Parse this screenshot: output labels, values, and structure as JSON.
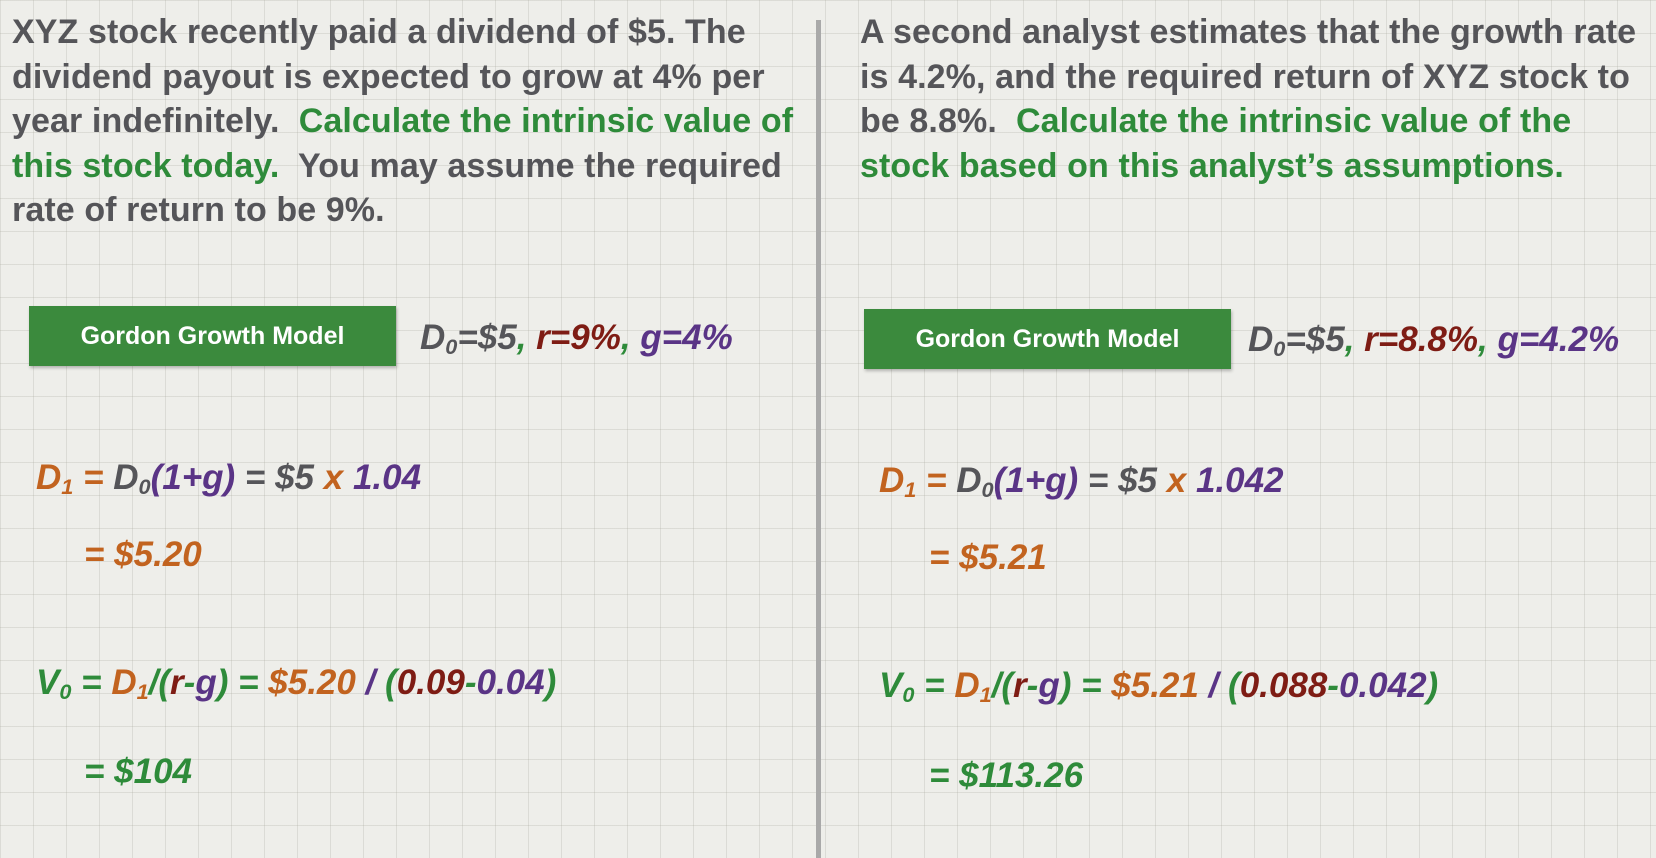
{
  "left": {
    "problem": {
      "text_1": "XYZ stock recently paid a dividend of $5. The dividend payout is expected to grow at 4% per year indefinitely.",
      "green": "Calculate the intrinsic value of this stock today.",
      "text_2": "You may assume the required rate of return to be 9%."
    },
    "model_label": "Gordon Growth Model",
    "given": {
      "d0": "D",
      "d0_sub": "0",
      "d0_val": "=$5",
      "sep": ", ",
      "r": "r=9%",
      "g": "g=4%"
    },
    "d1_line": {
      "d": "D",
      "sub": "1",
      "eq1": " = ",
      "d0": "D",
      "d0_sub": "0",
      "paren": "(1+g)",
      "eq2": " = $5 ",
      "x": "x ",
      "num": "1.04"
    },
    "d1_result": "= $5.20",
    "v0_line": {
      "v": "V",
      "v_sub": "0",
      "eq1": " = ",
      "d": "D",
      "d_sub": "1",
      "slash": "/(",
      "r": "r",
      "minus": "-",
      "g": "g",
      "close": ")",
      "eq2": " = ",
      "val": "$5.20",
      "div": " / ",
      "open": "(",
      "rv": "0.09",
      "minus2": "-",
      "gv": "0.04",
      "close2": ")"
    },
    "v0_result": "= $104"
  },
  "right": {
    "problem": {
      "text_1": "A second analyst estimates that the growth rate is 4.2%, and the required return of XYZ stock to be 8.8%.",
      "green": "Calculate the intrinsic value of the stock based on this analyst’s assumptions."
    },
    "model_label": "Gordon Growth Model",
    "given": {
      "d0": "D",
      "d0_sub": "0",
      "d0_val": "=$5",
      "sep": ", ",
      "r": "r=8.8%",
      "g": "g=4.2%"
    },
    "d1_line": {
      "d": "D",
      "sub": "1",
      "eq1": " = ",
      "d0": "D",
      "d0_sub": "0",
      "paren": "(1+g)",
      "eq2": " = $5 ",
      "x": "x ",
      "num": "1.042"
    },
    "d1_result": "= $5.21",
    "v0_line": {
      "v": "V",
      "v_sub": "0",
      "eq1": " = ",
      "d": "D",
      "d_sub": "1",
      "slash": "/(",
      "r": "r",
      "minus": "-",
      "g": "g",
      "close": ")",
      "eq2": " = ",
      "val": "$5.21",
      "div": " / ",
      "open": "(",
      "rv": "0.088",
      "minus2": "-",
      "gv": "0.042",
      "close2": ")"
    },
    "v0_result": "= $113.26"
  }
}
